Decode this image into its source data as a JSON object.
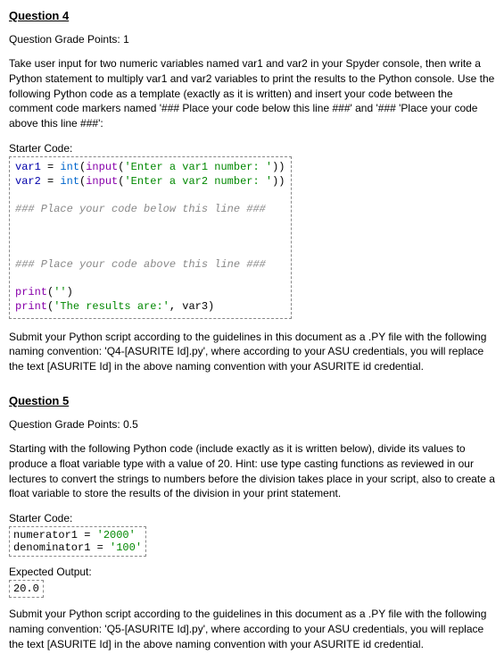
{
  "q4": {
    "header": "Question 4",
    "grade": "Question Grade Points: 1",
    "body": "Take user input for two numeric variables named var1 and var2 in your Spyder console, then write a Python statement to multiply var1 and var2 variables to print the results to the Python console. Use the following Python code as a template (exactly as it is written) and insert your code between the comment code markers named '### Place your code below this line ###' and '### 'Place your code above this line ###':",
    "starter_label": "Starter Code:",
    "code": {
      "l1_var1": "var1",
      "l1_eq": " = ",
      "l1_int": "int",
      "l1_p1": "(",
      "l1_input": "input",
      "l1_p2": "(",
      "l1_str": "'Enter a var1 number: '",
      "l1_p3": "))",
      "l2_var2": "var2",
      "l2_eq": " = ",
      "l2_int": "int",
      "l2_p1": "(",
      "l2_input": "input",
      "l2_p2": "(",
      "l2_str": "'Enter a var2 number: '",
      "l2_p3": "))",
      "c1": "### Place your code below this line ###",
      "c2": "### Place your code above this line ###",
      "p1_print": "print",
      "p1_p1": "(",
      "p1_str": "''",
      "p1_p2": ")",
      "p2_print": "print",
      "p2_p1": "(",
      "p2_str": "'The results are:'",
      "p2_comma": ", var3)",
      "blank": ""
    },
    "footer": "Submit your Python script according to the guidelines in this document as a .PY file with the following naming convention: 'Q4-[ASURITE Id].py', where according to your ASU credentials, you will replace the text [ASURITE Id] in the above naming convention with your ASURITE id credential."
  },
  "q5": {
    "header": "Question 5",
    "grade": "Question Grade Points: 0.5",
    "body": "Starting with the following Python code (include exactly as it is written below), divide its values to produce a float variable type with a value of 20. Hint: use type casting functions as reviewed in our lectures to convert the strings to numbers before the division takes place in your script, also to create a float variable to store the results of the division in your print statement.",
    "starter_label": "Starter Code:",
    "code": {
      "l1_num": "numerator1",
      "l1_eq": " = ",
      "l1_str": "'2000'",
      "l2_den": "denominator1",
      "l2_eq": " = ",
      "l2_str": "'100'"
    },
    "expected_label": "Expected Output:",
    "expected": "20.0",
    "footer": "Submit your Python script according to the guidelines in this document as a .PY file with the following naming convention: 'Q5-[ASURITE Id].py', where according to your ASU credentials, you will replace the text [ASURITE Id] in the above naming convention with your ASURITE id credential."
  }
}
